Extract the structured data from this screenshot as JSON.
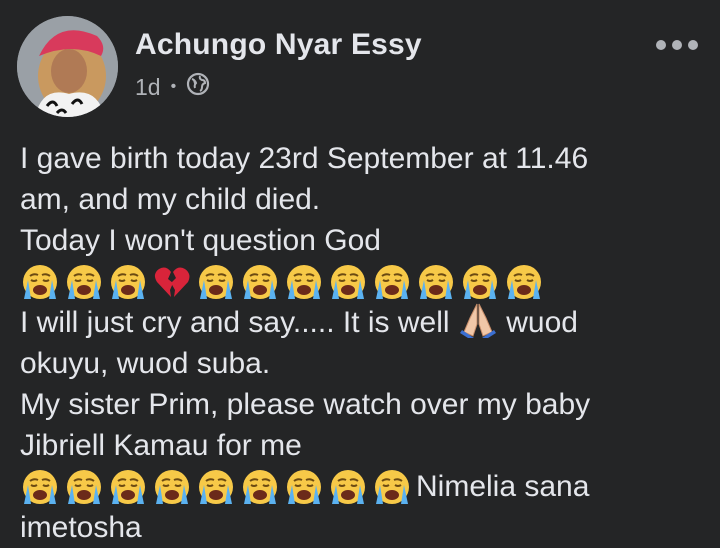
{
  "post": {
    "author": "Achungo Nyar Essy",
    "time": "1d",
    "separator": "•",
    "audience_icon": "globe-icon",
    "menu_icon": "more-dots-icon",
    "text_lines": [
      "I gave birth today 23rd September at 11.46",
      "am, and my child died.",
      "Today I won't question God"
    ],
    "line_cry_before": "I will just cry and say..... It is well",
    "line_cry_after": "wuod",
    "line_okuyu": "okuyu, wuod suba.",
    "line_sister": "My sister Prim, please watch over my baby",
    "line_jibriell": "Jibriell Kamau for me",
    "line_nimelia": "Nimelia sana",
    "line_last": "imetosha",
    "emoji_row_1": [
      "crying-face",
      "crying-face",
      "crying-face",
      "broken-heart",
      "crying-face",
      "crying-face",
      "crying-face",
      "crying-face",
      "crying-face",
      "crying-face",
      "crying-face",
      "crying-face"
    ],
    "emoji_row_2": [
      "crying-face",
      "crying-face",
      "crying-face",
      "crying-face",
      "crying-face",
      "crying-face",
      "crying-face",
      "crying-face",
      "crying-face"
    ],
    "inline_emoji": "folded-hands"
  },
  "colors": {
    "background": "#242526",
    "primary_text": "#e4e6eb",
    "secondary_text": "#b0b3b8"
  }
}
